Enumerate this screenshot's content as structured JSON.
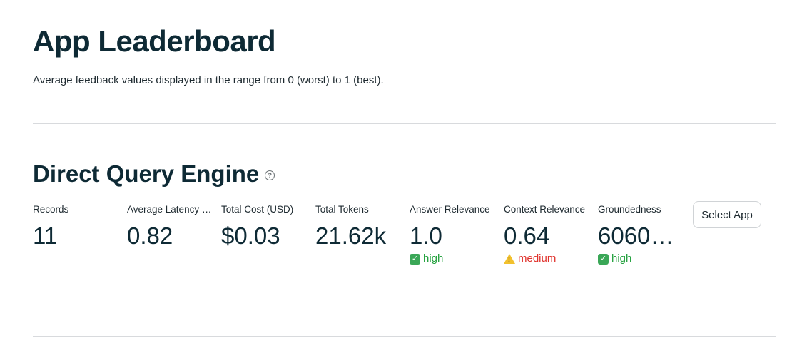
{
  "header": {
    "title": "App Leaderboard",
    "subtitle": "Average feedback values displayed in the range from 0 (worst) to 1 (best)."
  },
  "app": {
    "name": "Direct Query Engine",
    "help_icon": "question-circle-icon",
    "select_button_label": "Select App",
    "metrics": [
      {
        "label": "Records",
        "value": "11"
      },
      {
        "label": "Average Latency (…",
        "value": "0.82"
      },
      {
        "label": "Total Cost (USD)",
        "value": "$0.03"
      },
      {
        "label": "Total Tokens",
        "value": "21.62k"
      },
      {
        "label": "Answer Relevance",
        "value": "1.0",
        "delta": "high",
        "delta_icon": "check-mark-icon",
        "delta_color": "#21a03c"
      },
      {
        "label": "Context Relevance",
        "value": "0.64",
        "delta": "medium",
        "delta_icon": "warning-icon",
        "delta_color": "#e0312b"
      },
      {
        "label": "Groundedness",
        "value": "6060…",
        "delta": "high",
        "delta_icon": "check-mark-icon",
        "delta_color": "#21a03c"
      }
    ]
  },
  "colors": {
    "text_primary": "#0e2a35",
    "good": "#21a03c",
    "warn": "#e0312b",
    "divider": "#d8dadd"
  }
}
